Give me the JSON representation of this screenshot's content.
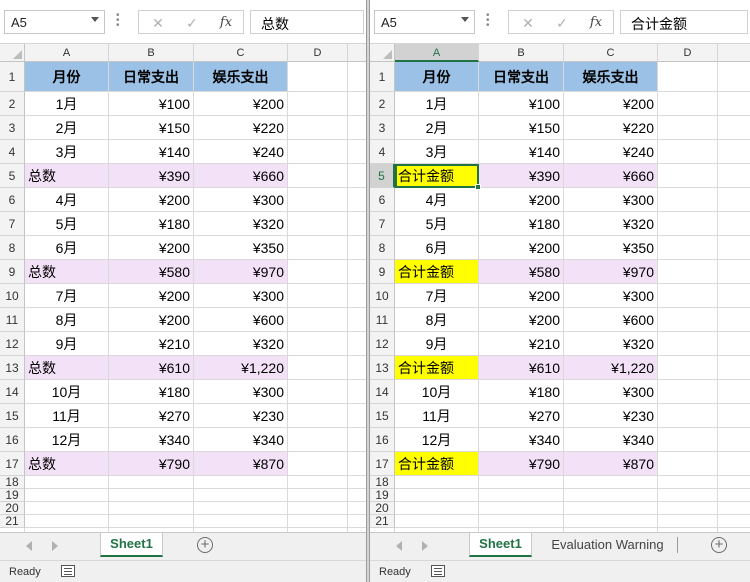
{
  "columns": [
    "A",
    "B",
    "C",
    "D"
  ],
  "rows": [
    "1",
    "2",
    "3",
    "4",
    "5",
    "6",
    "7",
    "8",
    "9",
    "10",
    "11",
    "12",
    "13",
    "14",
    "15",
    "16",
    "17",
    "18",
    "19",
    "20",
    "21"
  ],
  "left": {
    "namebox": "A5",
    "formula_value": "总数",
    "sheet_tab": "Sheet1",
    "status": "Ready",
    "header": [
      "月份",
      "日常支出",
      "娱乐支出"
    ],
    "data_rows": [
      [
        "1月",
        "¥100",
        "¥200"
      ],
      [
        "2月",
        "¥150",
        "¥220"
      ],
      [
        "3月",
        "¥140",
        "¥240"
      ],
      [
        "总数",
        "¥390",
        "¥660"
      ],
      [
        "4月",
        "¥200",
        "¥300"
      ],
      [
        "5月",
        "¥180",
        "¥320"
      ],
      [
        "6月",
        "¥200",
        "¥350"
      ],
      [
        "总数",
        "¥580",
        "¥970"
      ],
      [
        "7月",
        "¥200",
        "¥300"
      ],
      [
        "8月",
        "¥200",
        "¥600"
      ],
      [
        "9月",
        "¥210",
        "¥320"
      ],
      [
        "总数",
        "¥610",
        "¥1,220"
      ],
      [
        "10月",
        "¥180",
        "¥300"
      ],
      [
        "11月",
        "¥270",
        "¥230"
      ],
      [
        "12月",
        "¥340",
        "¥340"
      ],
      [
        "总数",
        "¥790",
        "¥870"
      ]
    ]
  },
  "right": {
    "namebox": "A5",
    "formula_value": "合计金额",
    "sheet_tab": "Sheet1",
    "extra_tab": "Evaluation Warning",
    "status": "Ready",
    "header": [
      "月份",
      "日常支出",
      "娱乐支出"
    ],
    "data_rows": [
      [
        "1月",
        "¥100",
        "¥200"
      ],
      [
        "2月",
        "¥150",
        "¥220"
      ],
      [
        "3月",
        "¥140",
        "¥240"
      ],
      [
        "合计金额",
        "¥390",
        "¥660"
      ],
      [
        "4月",
        "¥200",
        "¥300"
      ],
      [
        "5月",
        "¥180",
        "¥320"
      ],
      [
        "6月",
        "¥200",
        "¥350"
      ],
      [
        "合计金额",
        "¥580",
        "¥970"
      ],
      [
        "7月",
        "¥200",
        "¥300"
      ],
      [
        "8月",
        "¥200",
        "¥600"
      ],
      [
        "9月",
        "¥210",
        "¥320"
      ],
      [
        "合计金额",
        "¥610",
        "¥1,220"
      ],
      [
        "10月",
        "¥180",
        "¥300"
      ],
      [
        "11月",
        "¥270",
        "¥230"
      ],
      [
        "12月",
        "¥340",
        "¥340"
      ],
      [
        "合计金额",
        "¥790",
        "¥870"
      ]
    ]
  },
  "colors": {
    "header_fill": "#9bc2e6",
    "total_row_fill": "#f3e2f7",
    "highlight_fill": "#ffff00",
    "accent": "#217346"
  },
  "icons": {
    "cancel": "✕",
    "confirm": "✓",
    "function": "fx",
    "add_sheet": "+"
  }
}
